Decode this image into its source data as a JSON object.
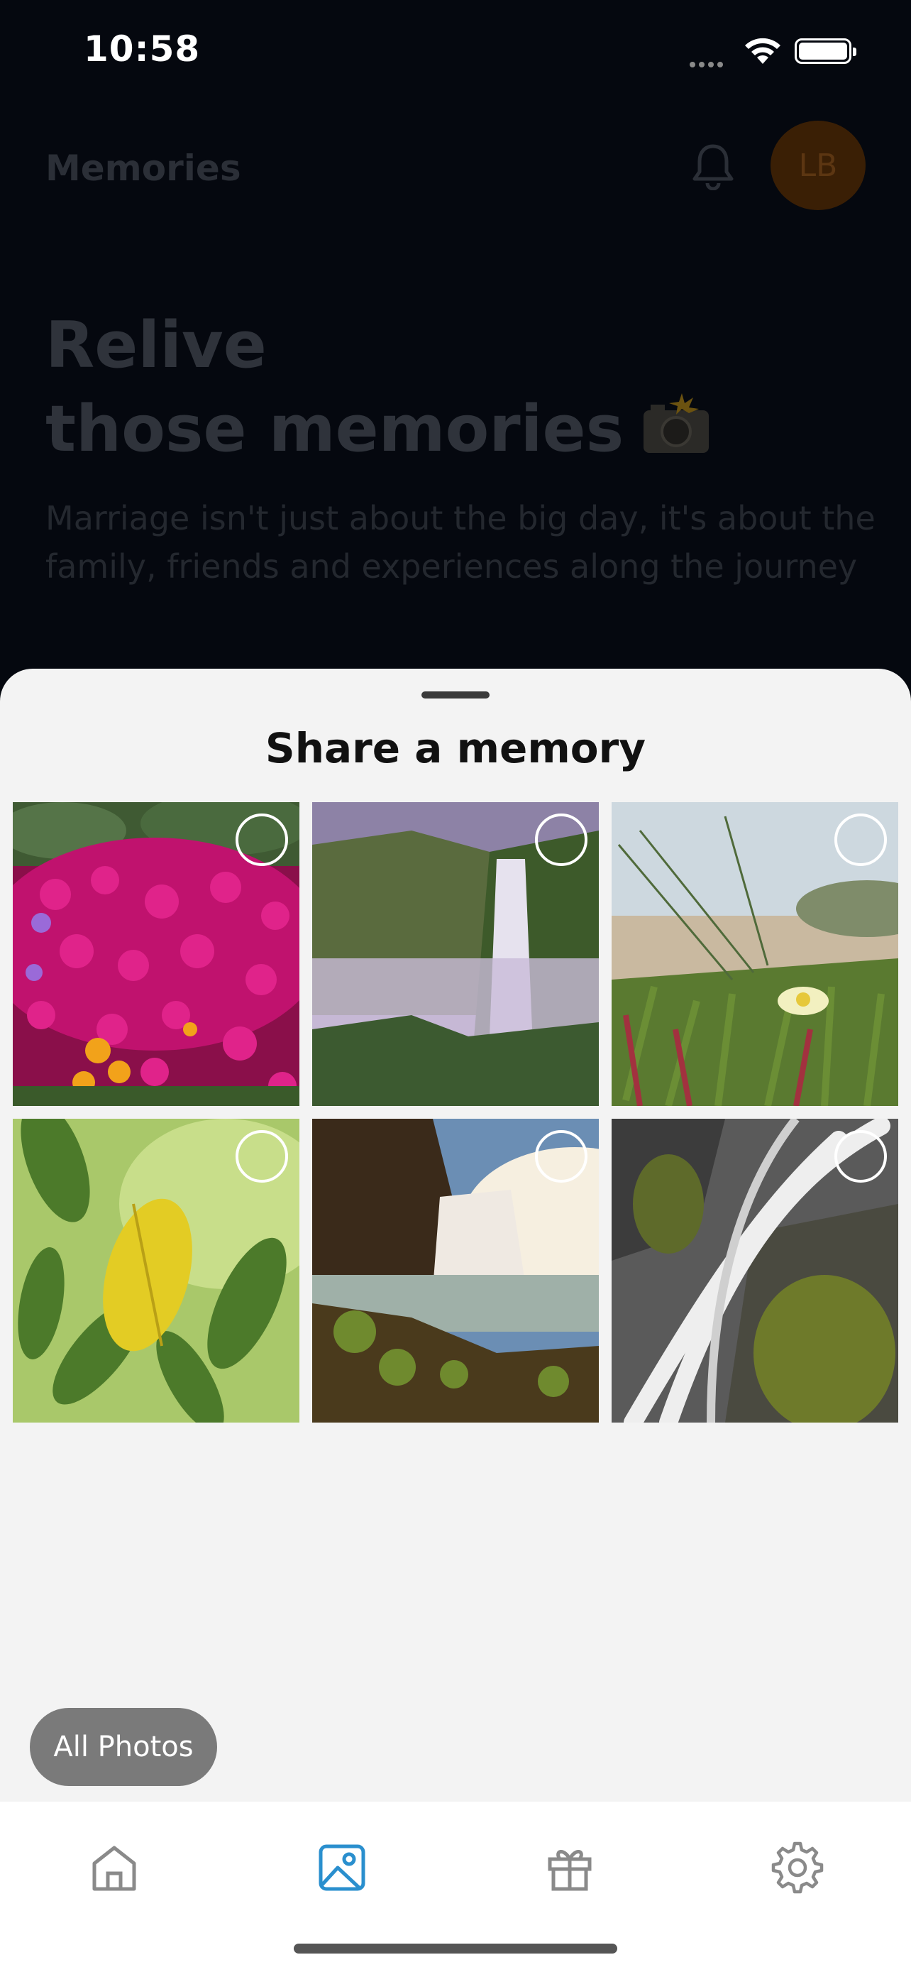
{
  "status_bar": {
    "time": "10:58"
  },
  "header": {
    "title": "Memories",
    "avatar_initials": "LB"
  },
  "hero": {
    "title_line1": "Relive",
    "title_line2": "those memories",
    "subtitle": "Marriage isn't just about the big day, it's about the family, friends and experiences along the journey"
  },
  "sheet": {
    "title": "Share a memory",
    "all_photos_label": "All Photos",
    "photos": [
      {
        "subject": "magenta flowers",
        "selected": false
      },
      {
        "subject": "misty waterfall",
        "selected": false
      },
      {
        "subject": "beach grass flower",
        "selected": false
      },
      {
        "subject": "yellow leaf",
        "selected": false
      },
      {
        "subject": "waterfall at sunrise",
        "selected": false
      },
      {
        "subject": "long exposure cascade",
        "selected": false
      }
    ]
  },
  "tab_bar": {
    "tabs": [
      {
        "icon": "home-icon",
        "active": false
      },
      {
        "icon": "image-icon",
        "active": true
      },
      {
        "icon": "gift-icon",
        "active": false
      },
      {
        "icon": "gear-icon",
        "active": false
      }
    ],
    "active_color": "#2a8fce",
    "inactive_color": "#8a8a8a"
  },
  "colors": {
    "avatar_bg": "#3a1f05",
    "sheet_bg": "#f3f3f3"
  }
}
